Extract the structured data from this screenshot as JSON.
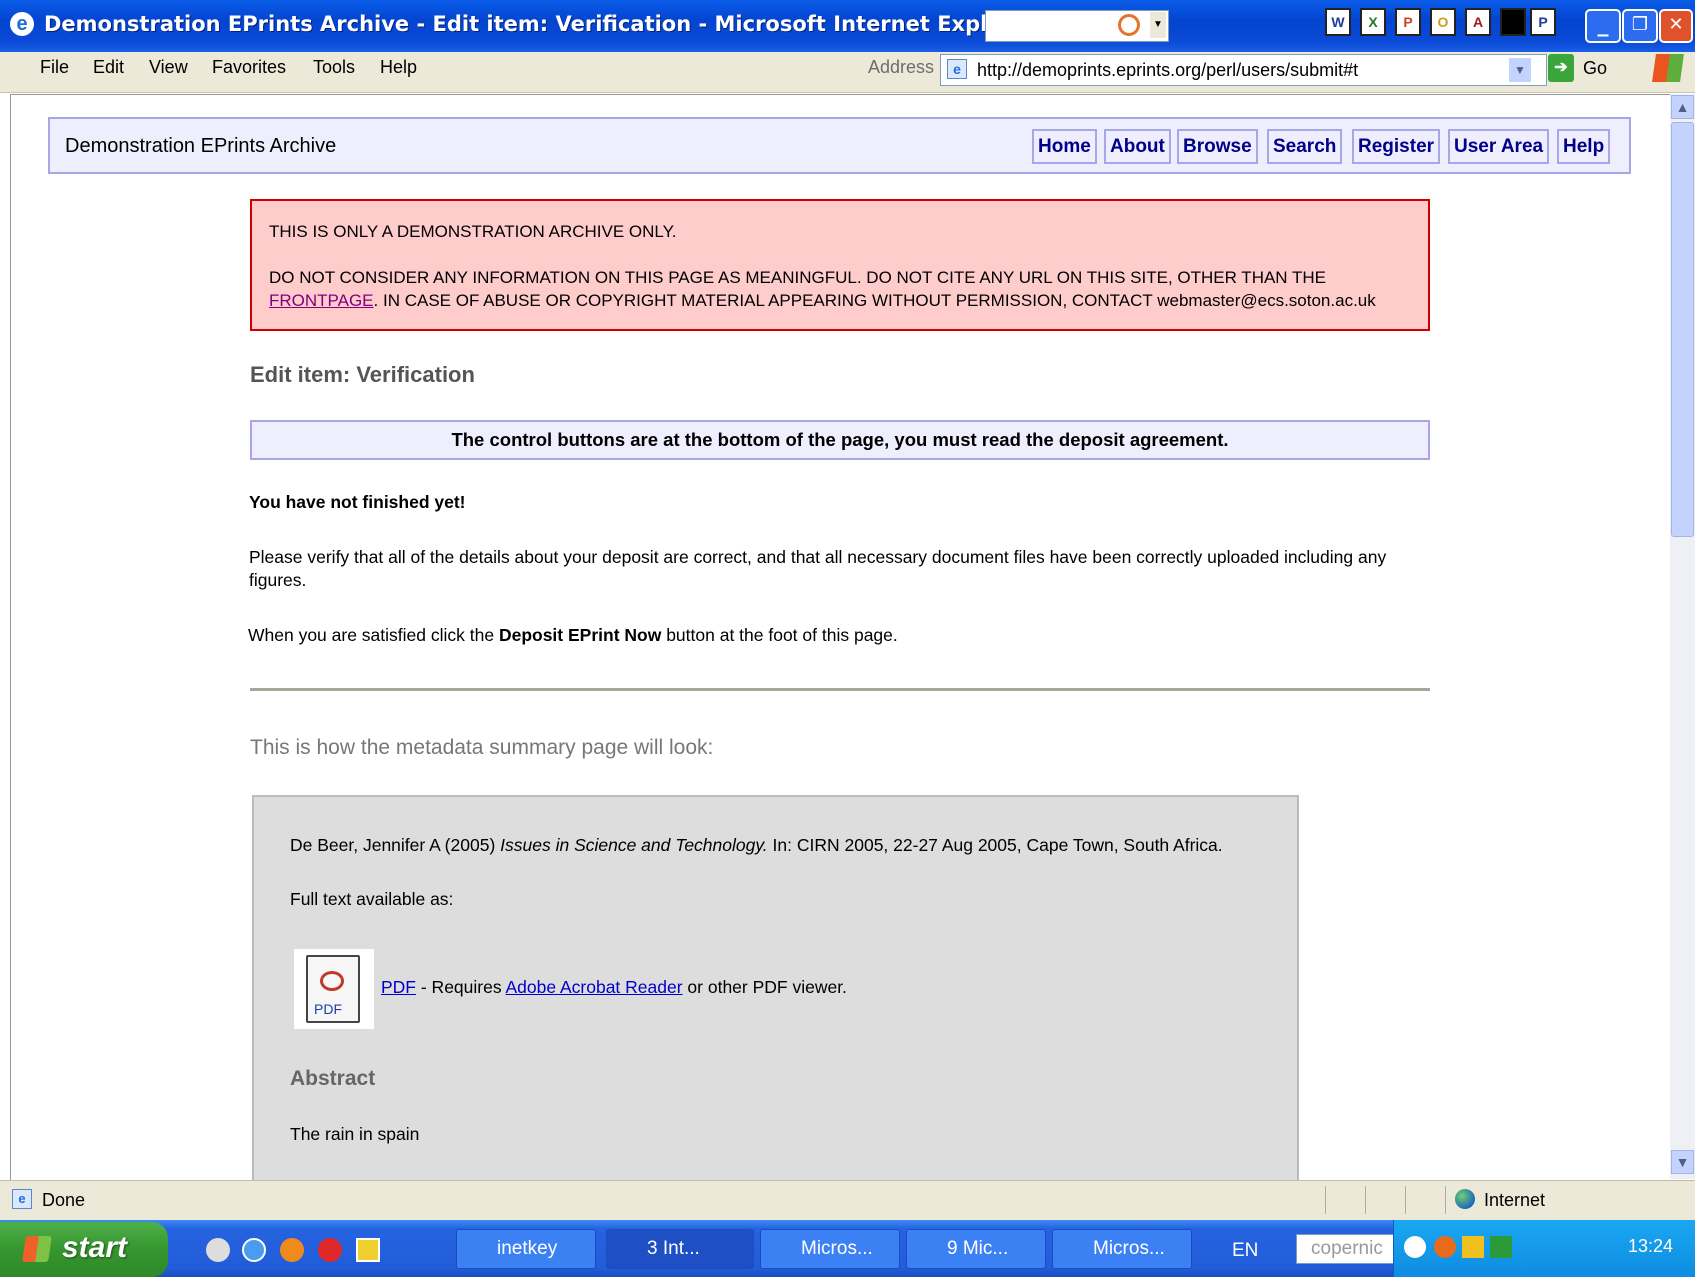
{
  "window": {
    "title": "Demonstration EPrints Archive - Edit item: Verification - Microsoft Internet Explorer",
    "minimize": "_",
    "maximize": "❐",
    "close": "✕"
  },
  "menubar": {
    "items": [
      "File",
      "Edit",
      "View",
      "Favorites",
      "Tools",
      "Help"
    ],
    "address_label": "Address",
    "address_url": "http://demoprints.eprints.org/perl/users/submit#t",
    "go_label": "Go"
  },
  "site": {
    "name": "Demonstration EPrints Archive",
    "nav": [
      "Home",
      "About",
      "Browse",
      "Search",
      "Register",
      "User Area",
      "Help"
    ]
  },
  "alert": {
    "line1": "THIS IS ONLY A DEMONSTRATION ARCHIVE ONLY.",
    "line2": "DO NOT CONSIDER ANY INFORMATION ON THIS PAGE AS MEANINGFUL. DO NOT CITE ANY URL ON THIS SITE, OTHER THAN THE",
    "link": "FRONTPAGE",
    "line3": ". IN CASE OF ABUSE OR COPYRIGHT MATERIAL APPEARING WITHOUT PERMISSION, CONTACT webmaster@ecs.soton.ac.uk"
  },
  "page": {
    "heading": "Edit item: Verification",
    "notice": "The control buttons are at the bottom of the page, you must read the deposit agreement.",
    "not_finished": "You have not finished yet!",
    "verify_line1": "Please verify that all of the details about your deposit are correct, and that all necessary document files have been correctly uploaded including any",
    "verify_line2": "figures.",
    "satisfied_pre": "When you are satisfied click the ",
    "satisfied_bold": "Deposit EPrint Now",
    "satisfied_post": " button at the foot of this page.",
    "summary_intro": "This is how the metadata summary page will look:"
  },
  "summary": {
    "citation_pre": "De Beer, Jennifer A (2005) ",
    "citation_title": "Issues in Science and Technology.",
    "citation_post": " In: CIRN 2005, 22-27 Aug 2005, Cape Town, South Africa.",
    "fulltext": "Full text available as:",
    "pdf_icon_label": "PDF",
    "pdf_link": "PDF",
    "requires": " - Requires ",
    "reader_link": "Adobe Acrobat Reader",
    "viewer": " or other PDF viewer.",
    "abstract_heading": "Abstract",
    "abstract_text": "The rain in spain"
  },
  "statusbar": {
    "status": "Done",
    "zone": "Internet"
  },
  "taskbar": {
    "start": "start",
    "tasks": [
      "inetkey",
      "3 Int...",
      "Micros...",
      "9 Mic...",
      "Micros..."
    ],
    "lang": "EN",
    "search_box": "copernic",
    "clock": "13:24"
  }
}
